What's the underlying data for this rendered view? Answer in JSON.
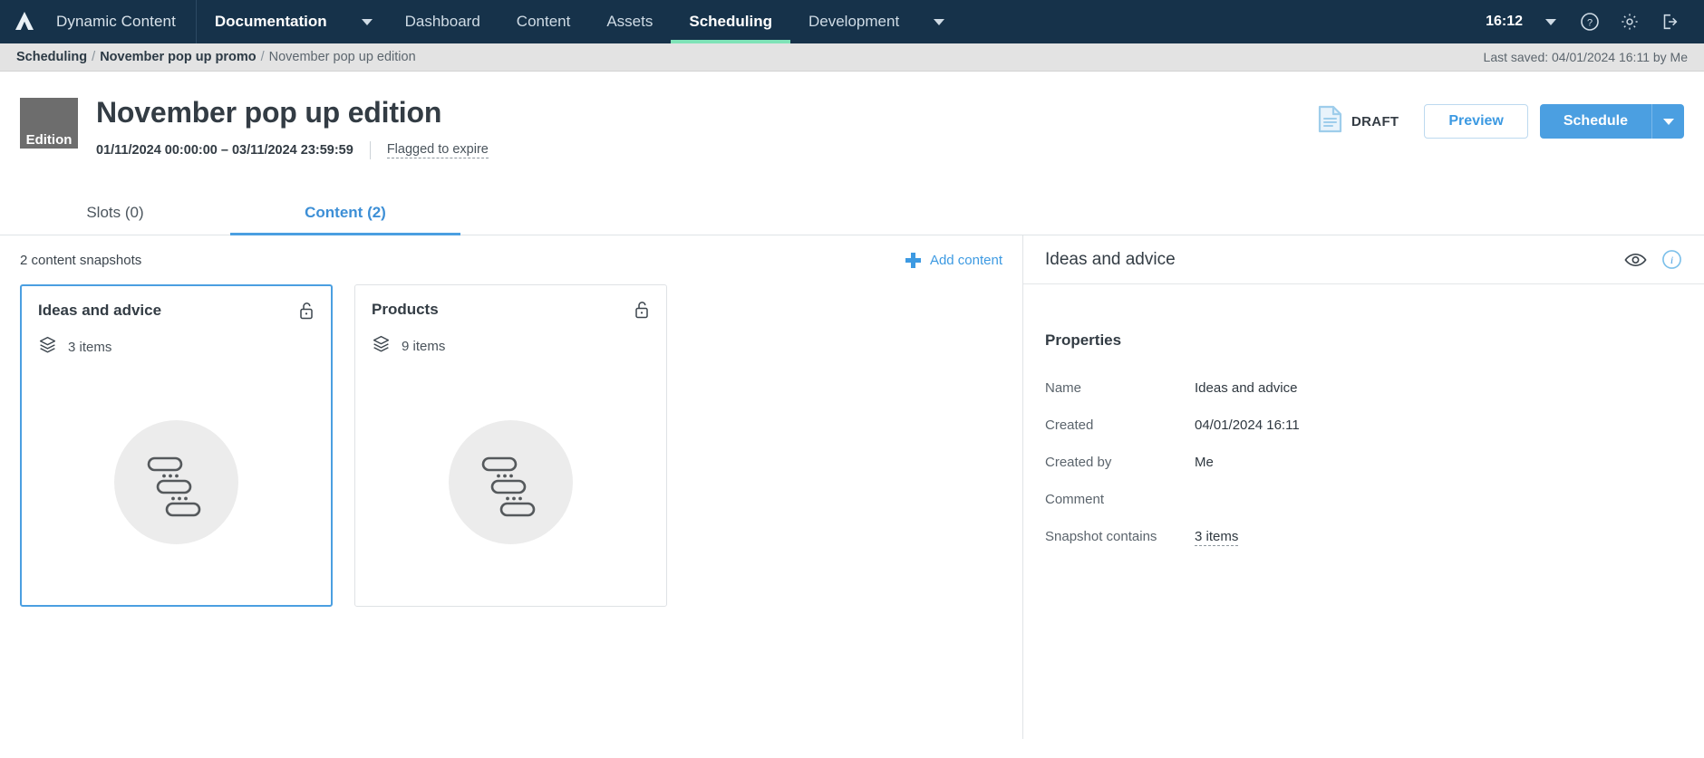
{
  "topnav": {
    "logo_icon": "amplience-logo-icon",
    "brand": "Dynamic Content",
    "items": [
      {
        "label": "Documentation",
        "active": false,
        "strong": true,
        "caret": true
      },
      {
        "label": "Dashboard",
        "active": false,
        "strong": false,
        "caret": false
      },
      {
        "label": "Content",
        "active": false,
        "strong": false,
        "caret": false
      },
      {
        "label": "Assets",
        "active": false,
        "strong": false,
        "caret": false
      },
      {
        "label": "Scheduling",
        "active": true,
        "strong": true,
        "caret": false
      },
      {
        "label": "Development",
        "active": false,
        "strong": false,
        "caret": true
      }
    ],
    "time": "16:12",
    "help_icon": "help-circle-icon",
    "settings_icon": "gear-icon",
    "logout_icon": "logout-icon",
    "accent_color": "#7fe3b8",
    "background_color": "#16324a"
  },
  "breadcrumb": {
    "items": [
      "Scheduling",
      "November pop up promo",
      "November pop up edition"
    ],
    "separator": "/",
    "last_saved": "Last saved: 04/01/2024 16:11 by Me"
  },
  "header": {
    "badge": "Edition",
    "title": "November pop up edition",
    "date_range": "01/11/2024 00:00:00  –  03/11/2024 23:59:59",
    "flagged": "Flagged to expire",
    "status": "DRAFT",
    "status_icon": "draft-document-icon",
    "preview_label": "Preview",
    "schedule_label": "Schedule",
    "schedule_caret_icon": "chevron-down-icon",
    "primary_color": "#4b9fe1"
  },
  "tabs": [
    {
      "label": "Slots (0)",
      "active": false
    },
    {
      "label": "Content (2)",
      "active": true
    }
  ],
  "toolbar": {
    "snapshot_count": "2 content snapshots",
    "add_content_label": "Add content",
    "add_icon": "plus-icon"
  },
  "cards": [
    {
      "title": "Ideas and advice",
      "items": "3 items",
      "lock_icon": "unlocked-padlock-icon",
      "stack_icon": "layers-icon",
      "thumb_icon": "content-placeholder-icon",
      "selected": true
    },
    {
      "title": "Products",
      "items": "9 items",
      "lock_icon": "unlocked-padlock-icon",
      "stack_icon": "layers-icon",
      "thumb_icon": "content-placeholder-icon",
      "selected": false
    }
  ],
  "panel": {
    "title": "Ideas and advice",
    "eye_icon": "eye-icon",
    "info_icon": "info-circle-icon",
    "properties_heading": "Properties",
    "properties": [
      {
        "key": "Name",
        "value": "Ideas and advice",
        "link": false
      },
      {
        "key": "Created",
        "value": "04/01/2024 16:11",
        "link": false
      },
      {
        "key": "Created by",
        "value": "Me",
        "link": false
      },
      {
        "key": "Comment",
        "value": "",
        "link": false
      },
      {
        "key": "Snapshot contains",
        "value": "3 items",
        "link": true
      }
    ]
  }
}
